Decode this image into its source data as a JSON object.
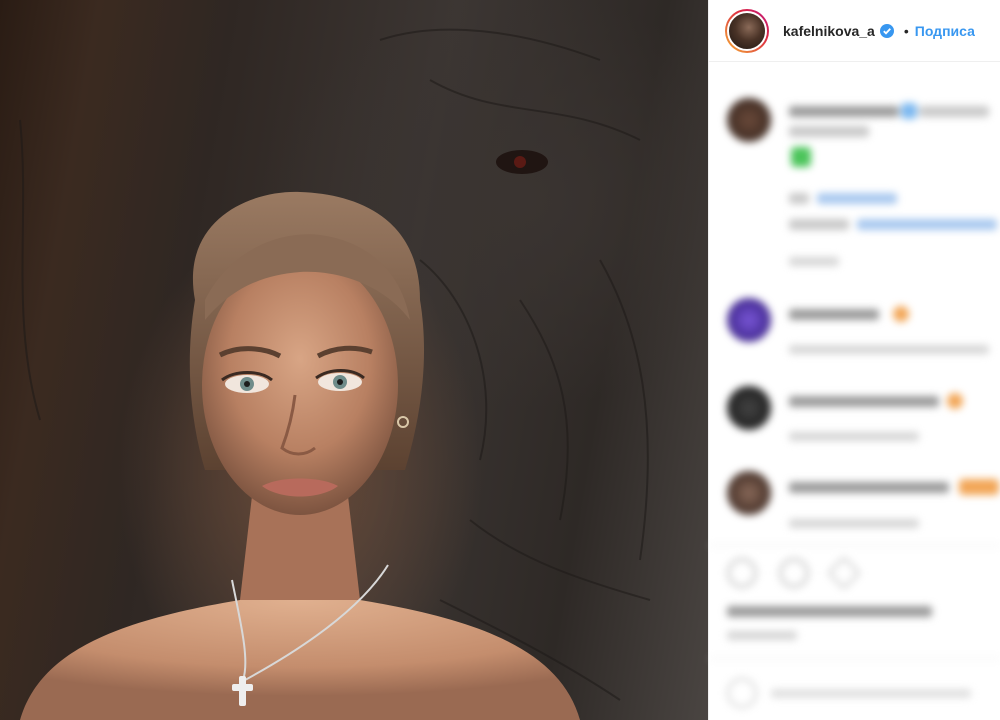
{
  "post": {
    "username": "kafelnikova_a",
    "follow_label": "Подписа",
    "separator": "•"
  },
  "icons": {
    "verified": "verified-badge-icon",
    "like": "heart-icon",
    "comment": "comment-icon",
    "share": "share-icon"
  },
  "colors": {
    "link": "#3897f0",
    "verified": "#3897f0",
    "username": "#262626",
    "story_ring": "#dc2743"
  }
}
